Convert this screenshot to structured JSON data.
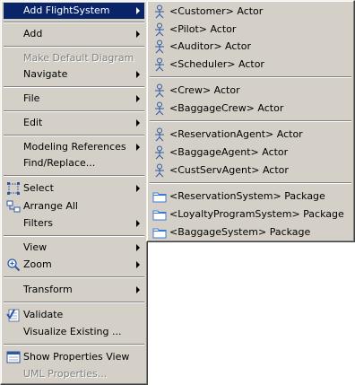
{
  "main_menu": {
    "add_flightsystem": "Add FlightSystem",
    "add": "Add",
    "make_default_diagram": "Make Default Diagram",
    "navigate": "Navigate",
    "file": "File",
    "edit": "Edit",
    "modeling_references": "Modeling References",
    "find_replace": "Find/Replace...",
    "select": "Select",
    "arrange_all": "Arrange All",
    "filters": "Filters",
    "view": "View",
    "zoom": "Zoom",
    "transform": "Transform",
    "validate": "Validate",
    "visualize_existing": "Visualize Existing ...",
    "show_properties_view": "Show Properties View",
    "uml_properties": "UML Properties..."
  },
  "submenu": {
    "customer": "<Customer> Actor",
    "pilot": "<Pilot> Actor",
    "auditor": "<Auditor> Actor",
    "scheduler": "<Scheduler> Actor",
    "crew": "<Crew> Actor",
    "baggage_crew": "<BaggageCrew> Actor",
    "reservation_agent": "<ReservationAgent> Actor",
    "baggage_agent": "<BaggageAgent> Actor",
    "cust_serv_agent": "<CustServAgent> Actor",
    "reservation_system": "<ReservationSystem> Package",
    "loyalty_program_system": "<LoyaltyProgramSystem> Package",
    "baggage_system": "<BaggageSystem> Package"
  },
  "colors": {
    "menu_background": "#d4d0c8",
    "highlight": "#0a246a",
    "disabled_text": "#808080",
    "actor_icon": "#2d58a8",
    "package_icon": "#3a7bd5"
  }
}
